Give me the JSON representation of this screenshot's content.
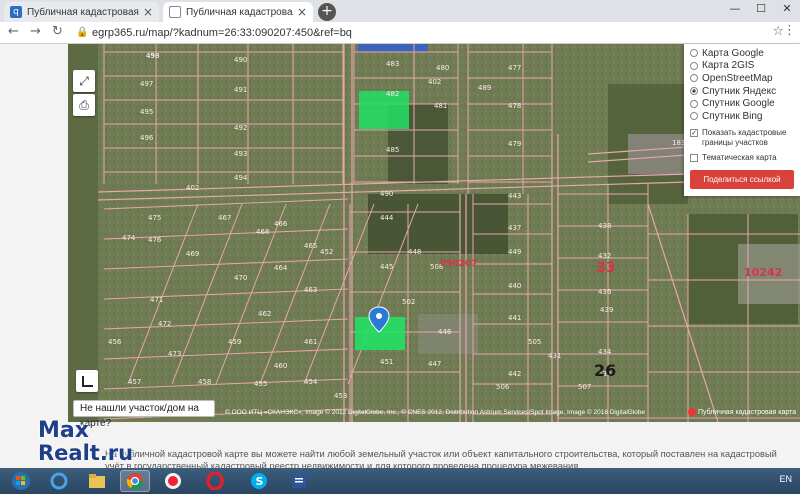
{
  "browser": {
    "tabs": [
      {
        "label": "Публичная кадастровая карта",
        "close": "×"
      },
      {
        "label": "Публичная кадастровая карта",
        "close": "×"
      }
    ],
    "new_tab": "+",
    "window_controls": {
      "minimize": "—",
      "maximize": "☐",
      "close": "✕"
    },
    "back": "←",
    "forward": "→",
    "reload": "↻",
    "url": "egrp365.ru/map/?kadnum=26:33:090207:450&ref=bq",
    "star": "☆",
    "menu": "⋮"
  },
  "map": {
    "layers": [
      {
        "label": "Карта Google",
        "selected": false
      },
      {
        "label": "Карта 2GIS",
        "selected": false
      },
      {
        "label": "OpenStreetMap",
        "selected": false
      },
      {
        "label": "Спутник Яндекс",
        "selected": true
      },
      {
        "label": "Спутник Google",
        "selected": false
      },
      {
        "label": "Спутник Bing",
        "selected": false
      }
    ],
    "show_borders": {
      "label": "Показать кадастровые границы участков",
      "checked": true
    },
    "thematic": {
      "label": "Тематическая карта",
      "checked": false
    },
    "share_button": "Поделиться ссылкой",
    "not_found": "Не нашли участок/дом на карте?",
    "attribution": "© ООО ИТЦ «СКАНЭКС», Image © 2012 DigitalGlobe, Inc., © CNES 2012, Distribution Astrium Services/Spot Image, Image © 2018 DigitalGlobe",
    "public_map_label": "Публичная кадастровая карта",
    "plot_labels": [
      "498",
      "490",
      "497",
      "491",
      "492",
      "493",
      "494",
      "495",
      "496",
      "483",
      "480",
      "477",
      "482",
      "481",
      "478",
      "485",
      "479",
      "475",
      "476",
      "474",
      "468",
      "469",
      "470",
      "471",
      "472",
      "473",
      "467",
      "466",
      "465",
      "464",
      "463",
      "462",
      "461",
      "460",
      "459",
      "458",
      "457",
      "456",
      "455",
      "454",
      "453",
      "452",
      "451",
      "447",
      "444",
      "446",
      "445",
      "448",
      "449",
      "440",
      "441",
      "442",
      "443",
      "437",
      "438",
      "439",
      "436",
      "434",
      "433",
      "432",
      "431",
      "508",
      "507",
      "506",
      "505",
      "502",
      "402",
      "489",
      "490",
      "450"
    ],
    "block_labels": [
      "33",
      "26",
      "090207",
      "10242"
    ],
    "road_labels": [
      "402",
      "183"
    ]
  },
  "description": "На публичной кадастровой карте вы можете найти любой земельный участок или объект капитального строительства, который поставлен на кадастровый учёт в государственный кадастровый реестр недвижимости и для которого проведена процедура межевания.",
  "watermark": {
    "line1": "Max",
    "line2": "Realt.ru"
  },
  "taskbar": {
    "tray_lang": "EN"
  },
  "colors": {
    "parcel_border": "#e8a6ad",
    "selected_parcel": "#22e064",
    "share_button": "#d9413b",
    "map_pin": "#2a78d8"
  }
}
